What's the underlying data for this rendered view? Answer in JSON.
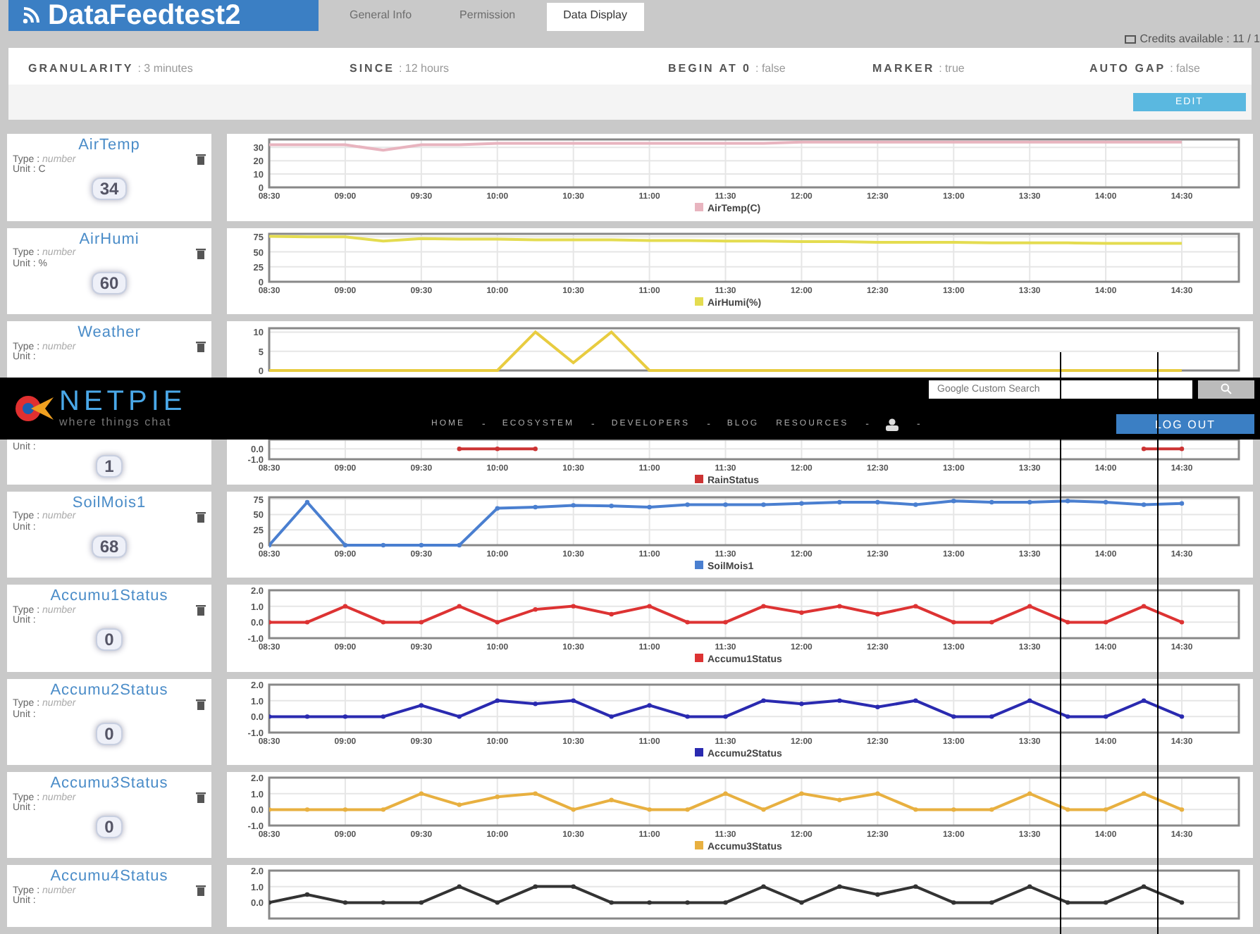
{
  "header": {
    "title": "DataFeedtest2",
    "tabs": [
      {
        "label": "General Info",
        "selected": false
      },
      {
        "label": "Permission",
        "selected": false
      },
      {
        "label": "Data Display",
        "selected": true
      }
    ],
    "credits": "Credits available : 11 / 1"
  },
  "settings": [
    {
      "label": "GRANULARITY",
      "value": ": 3 minutes"
    },
    {
      "label": "SINCE",
      "value": ": 12 hours"
    },
    {
      "label": "BEGIN AT 0",
      "value": ": false"
    },
    {
      "label": "MARKER",
      "value": ": true"
    },
    {
      "label": "AUTO GAP",
      "value": ": false"
    }
  ],
  "edit_button": "EDIT",
  "feeds_before": [
    {
      "kind": "full",
      "name": "AirTemp",
      "type_label": "Type :",
      "type": "number",
      "unit_label": "Unit :",
      "unit": "C",
      "value": "34",
      "chart_data": {
        "type": "line",
        "categories": [
          "08:30",
          null,
          "09:00",
          null,
          "09:30",
          null,
          "10:00",
          null,
          "10:30",
          null,
          "11:00",
          null,
          "11:30",
          null,
          "12:00",
          null,
          "12:30",
          null,
          "13:00",
          null,
          "13:30",
          null,
          "14:00",
          null,
          "14:30"
        ],
        "ylim": [
          0,
          36
        ],
        "grid": true,
        "yticks": [
          0,
          10,
          20,
          30
        ],
        "series": [
          {
            "name": "AirTemp(C)",
            "color": "#e8b4bf",
            "values": [
              32,
              32,
              32,
              28,
              32,
              32,
              33,
              33,
              33,
              33,
              33,
              33,
              33,
              33,
              34,
              34,
              34,
              34,
              34,
              34,
              34,
              34,
              34,
              34,
              34
            ]
          }
        ]
      }
    },
    {
      "kind": "full",
      "name": "AirHumi",
      "type_label": "Type :",
      "type": "number",
      "unit_label": "Unit :",
      "unit": "%",
      "value": "60",
      "chart_data": {
        "type": "line",
        "categories": [
          "08:30",
          null,
          "09:00",
          null,
          "09:30",
          null,
          "10:00",
          null,
          "10:30",
          null,
          "11:00",
          null,
          "11:30",
          null,
          "12:00",
          null,
          "12:30",
          null,
          "13:00",
          null,
          "13:30",
          null,
          "14:00",
          null,
          "14:30"
        ],
        "ylim": [
          0,
          80
        ],
        "grid": true,
        "yticks": [
          0,
          25,
          50,
          75
        ],
        "series": [
          {
            "name": "AirHumi(%)",
            "color": "#e4dc50",
            "values": [
              76,
              75,
              75,
              68,
              72,
              71,
              71,
              70,
              70,
              70,
              69,
              69,
              68,
              68,
              67,
              67,
              66,
              66,
              66,
              65,
              65,
              65,
              64,
              64,
              64
            ]
          }
        ]
      }
    },
    {
      "kind": "top",
      "name": "Weather",
      "type_label": "Type :",
      "type": "number",
      "unit_label": "Unit :",
      "chart_data": {
        "type": "line",
        "categories": [
          null,
          null,
          null,
          null,
          null,
          null,
          null,
          null,
          null,
          null,
          null,
          null,
          null,
          null,
          null,
          null,
          null,
          null,
          null,
          null,
          null,
          null,
          null,
          null,
          null
        ],
        "ylim": [
          0,
          11
        ],
        "grid": true,
        "yticks": [
          0,
          5,
          10
        ],
        "series": [
          {
            "color": "#e8cc40",
            "values": [
              0,
              0,
              0,
              0,
              0,
              0,
              0,
              10,
              2,
              10,
              0,
              0,
              0,
              0,
              0,
              0,
              0,
              0,
              0,
              0,
              0,
              0,
              0,
              0,
              0
            ]
          }
        ]
      }
    }
  ],
  "netpie": {
    "logo": "NETPIE",
    "tagline": "where things chat",
    "search_placeholder": "Google Custom Search",
    "nav": [
      {
        "kind": "link",
        "label": "HOME"
      },
      {
        "kind": "sep",
        "label": "-"
      },
      {
        "kind": "link",
        "label": "ECOSYSTEM"
      },
      {
        "kind": "sep",
        "label": "-"
      },
      {
        "kind": "link",
        "label": "DEVELOPERS"
      },
      {
        "kind": "sep",
        "label": "-"
      },
      {
        "kind": "link",
        "label": "BLOG"
      },
      {
        "kind": "link",
        "label": "RESOURCES"
      },
      {
        "kind": "sep",
        "label": "-"
      },
      {
        "kind": "user"
      },
      {
        "kind": "sep",
        "label": "-"
      }
    ],
    "logout": "LOG OUT"
  },
  "feeds_after": [
    {
      "kind": "bottom",
      "unit_label": "Unit :",
      "value": "1",
      "chart_data": {
        "type": "line",
        "categories": [
          "08:30",
          null,
          "09:00",
          null,
          "09:30",
          null,
          "10:00",
          null,
          "10:30",
          null,
          "11:00",
          null,
          "11:30",
          null,
          "12:00",
          null,
          "12:30",
          null,
          "13:00",
          null,
          "13:30",
          null,
          "14:00",
          null,
          "14:30"
        ],
        "ylim": [
          -1,
          0.9
        ],
        "grid": true,
        "yticks": [
          {
            "value": 0,
            "label": "0.0"
          },
          {
            "value": -1,
            "label": "-1.0"
          }
        ],
        "series": [
          {
            "name": "RainStatus",
            "color": "#cc3333",
            "marker": true,
            "values": [
              null,
              null,
              null,
              null,
              null,
              0,
              0,
              0,
              null,
              null,
              null,
              null,
              null,
              null,
              null,
              null,
              null,
              null,
              null,
              null,
              null,
              null,
              null,
              0,
              0
            ]
          }
        ]
      }
    },
    {
      "kind": "full",
      "name": "SoilMois1",
      "type_label": "Type :",
      "type": "number",
      "unit_label": "Unit :",
      "value": "68",
      "chart_data": {
        "type": "line",
        "categories": [
          "08:30",
          null,
          "09:00",
          null,
          "09:30",
          null,
          "10:00",
          null,
          "10:30",
          null,
          "11:00",
          null,
          "11:30",
          null,
          "12:00",
          null,
          "12:30",
          null,
          "13:00",
          null,
          "13:30",
          null,
          "14:00",
          null,
          "14:30"
        ],
        "ylim": [
          0,
          78
        ],
        "grid": true,
        "yticks": [
          0,
          25,
          50,
          75
        ],
        "series": [
          {
            "name": "SoilMois1",
            "color": "#4a7fd0",
            "marker": true,
            "values": [
              0,
              70,
              0,
              0,
              0,
              0,
              60,
              62,
              65,
              64,
              62,
              66,
              66,
              66,
              68,
              70,
              70,
              66,
              72,
              70,
              70,
              72,
              70,
              66,
              68
            ]
          }
        ]
      }
    },
    {
      "kind": "full",
      "name": "Accumu1Status",
      "type_label": "Type :",
      "type": "number",
      "unit_label": "Unit :",
      "value": "0",
      "chart_data": {
        "type": "line",
        "categories": [
          "08:30",
          null,
          "09:00",
          null,
          "09:30",
          null,
          "10:00",
          null,
          "10:30",
          null,
          "11:00",
          null,
          "11:30",
          null,
          "12:00",
          null,
          "12:30",
          null,
          "13:00",
          null,
          "13:30",
          null,
          "14:00",
          null,
          "14:30"
        ],
        "ylim": [
          -1,
          2
        ],
        "yticks": [
          {
            "value": 2,
            "label": "2.0"
          },
          {
            "value": 1,
            "label": "1.0"
          },
          {
            "value": 0,
            "label": "0.0"
          },
          {
            "value": -1,
            "label": "-1.0"
          }
        ],
        "grid": true,
        "series": [
          {
            "name": "Accumu1Status",
            "color": "#dd3333",
            "marker": true,
            "values": [
              0,
              0,
              1,
              0,
              0,
              1,
              0,
              0.8,
              1,
              0.5,
              1,
              0,
              0,
              1,
              0.6,
              1,
              0.5,
              1,
              0,
              0,
              1,
              0,
              0,
              1,
              0
            ]
          }
        ]
      }
    },
    {
      "kind": "full",
      "name": "Accumu2Status",
      "type_label": "Type :",
      "type": "number",
      "unit_label": "Unit :",
      "value": "0",
      "chart_data": {
        "type": "line",
        "categories": [
          "08:30",
          null,
          "09:00",
          null,
          "09:30",
          null,
          "10:00",
          null,
          "10:30",
          null,
          "11:00",
          null,
          "11:30",
          null,
          "12:00",
          null,
          "12:30",
          null,
          "13:00",
          null,
          "13:30",
          null,
          "14:00",
          null,
          "14:30"
        ],
        "ylim": [
          -1,
          2
        ],
        "yticks": [
          {
            "value": 2,
            "label": "2.0"
          },
          {
            "value": 1,
            "label": "1.0"
          },
          {
            "value": 0,
            "label": "0.0"
          },
          {
            "value": -1,
            "label": "-1.0"
          }
        ],
        "grid": true,
        "series": [
          {
            "name": "Accumu2Status",
            "color": "#2a2ab0",
            "marker": true,
            "values": [
              0,
              0,
              0,
              0,
              0.7,
              0,
              1,
              0.8,
              1,
              0,
              0.7,
              0,
              0,
              1,
              0.8,
              1,
              0.6,
              1,
              0,
              0,
              1,
              0,
              0,
              1,
              0
            ]
          }
        ]
      }
    },
    {
      "kind": "full",
      "name": "Accumu3Status",
      "type_label": "Type :",
      "type": "number",
      "unit_label": "Unit :",
      "value": "0",
      "chart_data": {
        "type": "line",
        "categories": [
          "08:30",
          null,
          "09:00",
          null,
          "09:30",
          null,
          "10:00",
          null,
          "10:30",
          null,
          "11:00",
          null,
          "11:30",
          null,
          "12:00",
          null,
          "12:30",
          null,
          "13:00",
          null,
          "13:30",
          null,
          "14:00",
          null,
          "14:30"
        ],
        "ylim": [
          -1,
          2
        ],
        "yticks": [
          {
            "value": 2,
            "label": "2.0"
          },
          {
            "value": 1,
            "label": "1.0"
          },
          {
            "value": 0,
            "label": "0.0"
          },
          {
            "value": -1,
            "label": "-1.0"
          }
        ],
        "grid": true,
        "series": [
          {
            "name": "Accumu3Status",
            "color": "#e8b040",
            "marker": true,
            "values": [
              0,
              0,
              0,
              0,
              1,
              0.3,
              0.8,
              1,
              0,
              0.6,
              0,
              0,
              1,
              0,
              1,
              0.6,
              1,
              0,
              0,
              0,
              1,
              0,
              0,
              1,
              0
            ]
          }
        ]
      }
    },
    {
      "kind": "cut",
      "name": "Accumu4Status",
      "type_label": "Type :",
      "type": "number",
      "unit_label": "Unit :",
      "chart_data": {
        "type": "line",
        "categories": [
          null,
          null,
          null,
          null,
          null,
          null,
          null,
          null,
          null,
          null,
          null,
          null,
          null,
          null,
          null,
          null,
          null,
          null,
          null,
          null,
          null,
          null,
          null,
          null,
          null
        ],
        "ylim": [
          -1,
          2
        ],
        "yticks": [
          {
            "value": 2,
            "label": "2.0"
          },
          {
            "value": 1,
            "label": "1.0"
          },
          {
            "value": 0,
            "label": "0.0"
          }
        ],
        "grid": true,
        "series": [
          {
            "color": "#333333",
            "marker": true,
            "values": [
              0,
              0.5,
              0,
              0,
              0,
              1,
              0,
              1,
              1,
              0,
              0,
              0,
              0,
              1,
              0,
              1,
              0.5,
              1,
              0,
              0,
              1,
              0,
              0,
              1,
              0
            ]
          }
        ]
      }
    }
  ]
}
